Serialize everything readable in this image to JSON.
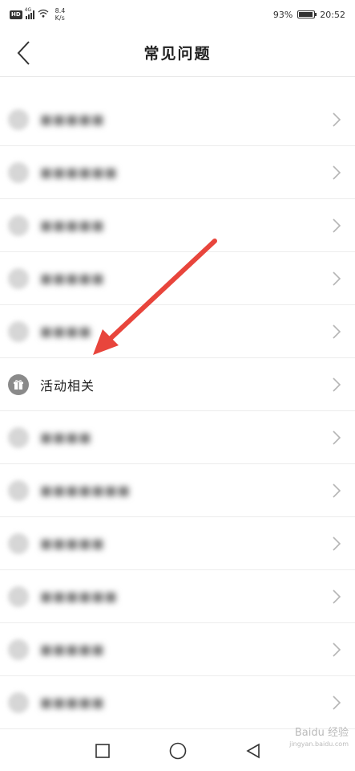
{
  "status_bar": {
    "hd": "HD",
    "network": "4G",
    "speed_value": "8.4",
    "speed_unit": "K/s",
    "battery_text": "93%",
    "battery_level": 0.93,
    "time": "20:52"
  },
  "header": {
    "title": "常见问题",
    "back_icon": "chevron-left-icon"
  },
  "list": {
    "items": [
      {
        "label": "■■■■■",
        "blurred": true
      },
      {
        "label": "■■■■■■",
        "blurred": true
      },
      {
        "label": "■■■■■",
        "blurred": true
      },
      {
        "label": "■■■■■",
        "blurred": true
      },
      {
        "label": "■■■■",
        "blurred": true
      },
      {
        "label": "活动相关",
        "blurred": false,
        "icon": "gift-icon"
      },
      {
        "label": "■■■■",
        "blurred": true
      },
      {
        "label": "■■■■■■■",
        "blurred": true
      },
      {
        "label": "■■■■■",
        "blurred": true
      },
      {
        "label": "■■■■■■",
        "blurred": true
      },
      {
        "label": "■■■■■",
        "blurred": true
      },
      {
        "label": "■■■■■",
        "blurred": true
      }
    ]
  },
  "nav_bar": {
    "recents_icon": "square-icon",
    "home_icon": "circle-icon",
    "back_icon": "triangle-back-icon"
  },
  "watermark": {
    "text": "Baidu 经验",
    "sub": "jingyan.baidu.com"
  },
  "colors": {
    "annotation_arrow": "#e8453c",
    "divider": "#ececec",
    "icon_gray": "#8a8a8a"
  }
}
